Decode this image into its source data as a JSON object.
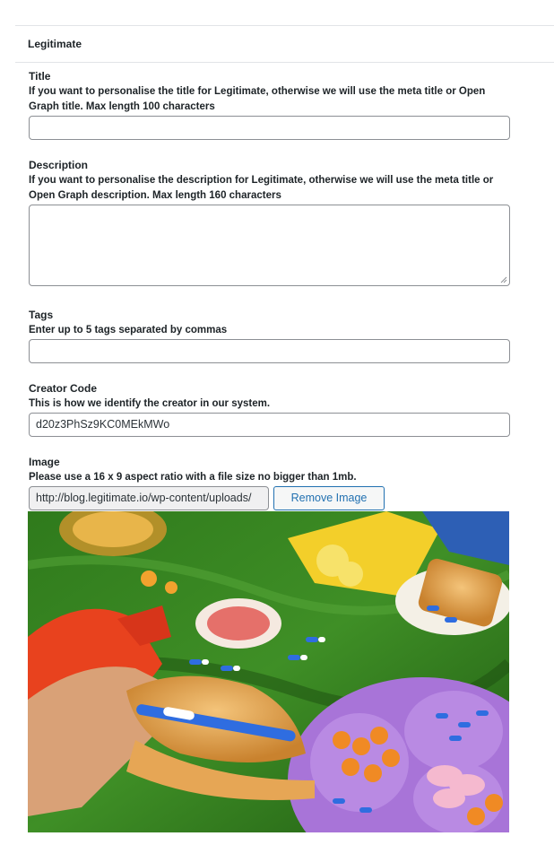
{
  "panel": {
    "title": "Legitimate"
  },
  "fields": {
    "title": {
      "label": "Title",
      "help": "If you want to personalise the title for Legitimate, otherwise we will use the meta title or Open Graph title. Max length 100 characters",
      "value": ""
    },
    "description": {
      "label": "Description",
      "help": "If you want to personalise the description for Legitimate, otherwise we will use the meta title or Open Graph description. Max length 160 characters",
      "value": ""
    },
    "tags": {
      "label": "Tags",
      "help": "Enter up to 5 tags separated by commas",
      "value": ""
    },
    "creator_code": {
      "label": "Creator Code",
      "help": "This is how we identify the creator in our system.",
      "value": "d20z3PhSz9KC0MEkMWo"
    },
    "image": {
      "label": "Image",
      "help": "Please use a 16 x 9 aspect ratio with a file size no bigger than 1mb.",
      "url_value": "http://blog.legitimate.io/wp-content/uploads/",
      "remove_label": "Remove Image"
    }
  },
  "colors": {
    "accent": "#2271b1",
    "border": "#8c8f94",
    "text": "#1d2327"
  }
}
